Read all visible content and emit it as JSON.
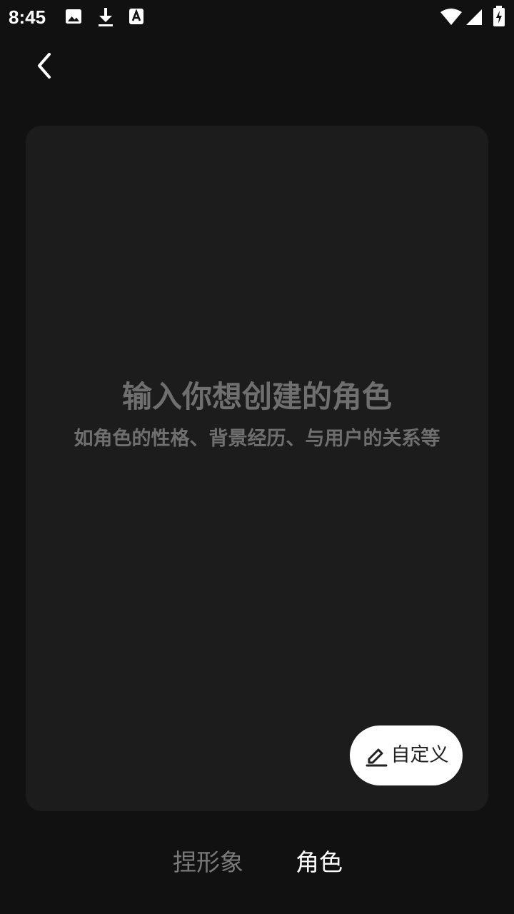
{
  "status_bar": {
    "time": "8:45",
    "icons": [
      "image-icon",
      "download-icon",
      "text-a-icon",
      "wifi-icon",
      "signal-icon",
      "battery-charging-icon"
    ]
  },
  "header": {
    "back_icon": "chevron-left-icon"
  },
  "card": {
    "prompt_title": "输入你想创建的角色",
    "prompt_subtitle": "如角色的性格、背景经历、与用户的关系等",
    "custom_button": {
      "icon": "pencil-icon",
      "label": "自定义"
    }
  },
  "tabs": [
    {
      "label": "捏形象",
      "active": false
    },
    {
      "label": "角色",
      "active": true
    }
  ],
  "colors": {
    "background": "#111111",
    "card": "#1c1c1c",
    "placeholder_text": "#6f6f6f",
    "active_tab": "#ffffff",
    "inactive_tab": "#7a7a7a"
  }
}
